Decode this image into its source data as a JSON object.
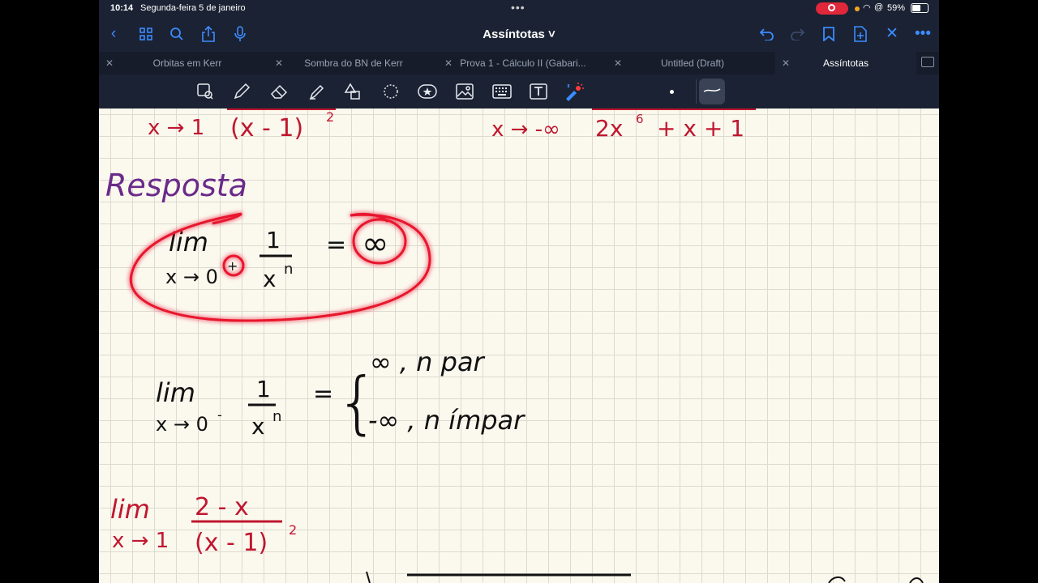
{
  "status": {
    "time": "10:14",
    "date": "Segunda-feira 5 de janeiro",
    "battery": "59%"
  },
  "nav": {
    "title": "Assíntotas ˅"
  },
  "tabs": [
    {
      "label": "Orbitas em Kerr"
    },
    {
      "label": "Sombra do BN de Kerr"
    },
    {
      "label": "Prova 1 - Cálculo II (Gabari..."
    },
    {
      "label": "Untitled (Draft)"
    },
    {
      "label": "Assíntotas"
    }
  ],
  "notes": {
    "top_left_bottom": "x → 1",
    "top_left_den": "(x - 1)",
    "top_left_exp": "2",
    "top_right_bottom": "x → -∞",
    "top_right_den": "2x",
    "top_right_exp": "6",
    "top_right_den_rest": "+ x + 1",
    "heading": "Resposta",
    "lim": "lim",
    "r1_under": "x → 0",
    "r1_sign": "+",
    "one": "1",
    "xn": "x",
    "n": "n",
    "eq": "=",
    "r1_result": "∞",
    "r2_under": "x → 0",
    "r2_sign": "-",
    "brace": "{",
    "case1": "∞ , n par",
    "case2": "-∞ , n ímpar",
    "ex_num": "2 - x",
    "ex_under": "x → 1",
    "ex_den": "(x - 1)",
    "ex_exp": "2"
  }
}
